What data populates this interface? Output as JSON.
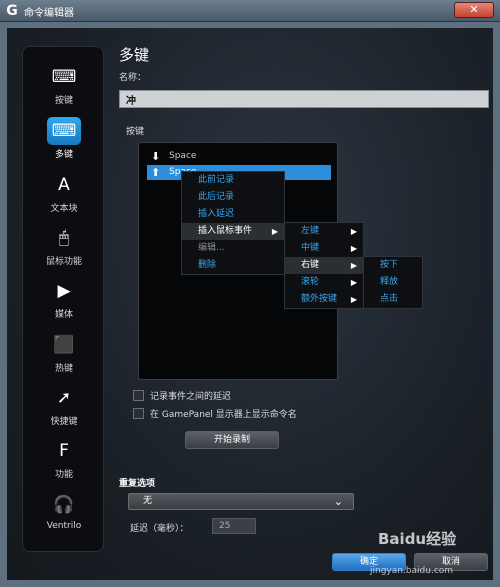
{
  "window": {
    "title": "命令编辑器",
    "logo": "G",
    "close": "✕"
  },
  "sidebar": {
    "items": [
      {
        "label": "按键",
        "icon": "key-icon",
        "glyph": "⌨"
      },
      {
        "label": "多键",
        "icon": "multikey-icon",
        "glyph": "⌨"
      },
      {
        "label": "文本块",
        "icon": "text-block-icon",
        "glyph": "A"
      },
      {
        "label": "鼠标功能",
        "icon": "mouse-icon",
        "glyph": "🖱"
      },
      {
        "label": "媒体",
        "icon": "play-icon",
        "glyph": "▶"
      },
      {
        "label": "热键",
        "icon": "hotkey-icon",
        "glyph": "⬛"
      },
      {
        "label": "快捷键",
        "icon": "shortcut-arrow-icon",
        "glyph": "➚"
      },
      {
        "label": "功能",
        "icon": "function-icon",
        "glyph": "F"
      },
      {
        "label": "Ventrilo",
        "icon": "headset-icon",
        "glyph": "🎧"
      }
    ],
    "active_index": 1
  },
  "main": {
    "title": "多键",
    "name_label": "名称：",
    "name_value": "冲",
    "keys_label": "按键",
    "keys": [
      {
        "label": "Space",
        "arrow": "⬇"
      },
      {
        "label": "Space",
        "arrow": "⬆"
      }
    ]
  },
  "context_menu": {
    "items": [
      "此前记录",
      "此后记录",
      "插入延迟",
      "插入鼠标事件",
      "编辑...",
      "删除"
    ],
    "submenu_mouse": [
      "左键",
      "中键",
      "右键",
      "滚轮",
      "额外按键"
    ],
    "submenu_right": [
      "按下",
      "释放",
      "点击"
    ]
  },
  "options": {
    "record_delays": "记录事件之间的延迟",
    "show_name": "在 GamePanel 显示器上显示命令名",
    "start_record": "开始录制"
  },
  "repeat": {
    "label": "重复选项",
    "value": "无",
    "delay_label": "延迟（毫秒）：",
    "delay_value": "25"
  },
  "footer": {
    "ok": "确定",
    "cancel": "取消"
  },
  "watermark": {
    "text": "Baidu经验",
    "url": "jingyan.baidu.com"
  },
  "colors": {
    "accent": "#2c8edb",
    "menu_text": "#3aa7ef"
  }
}
